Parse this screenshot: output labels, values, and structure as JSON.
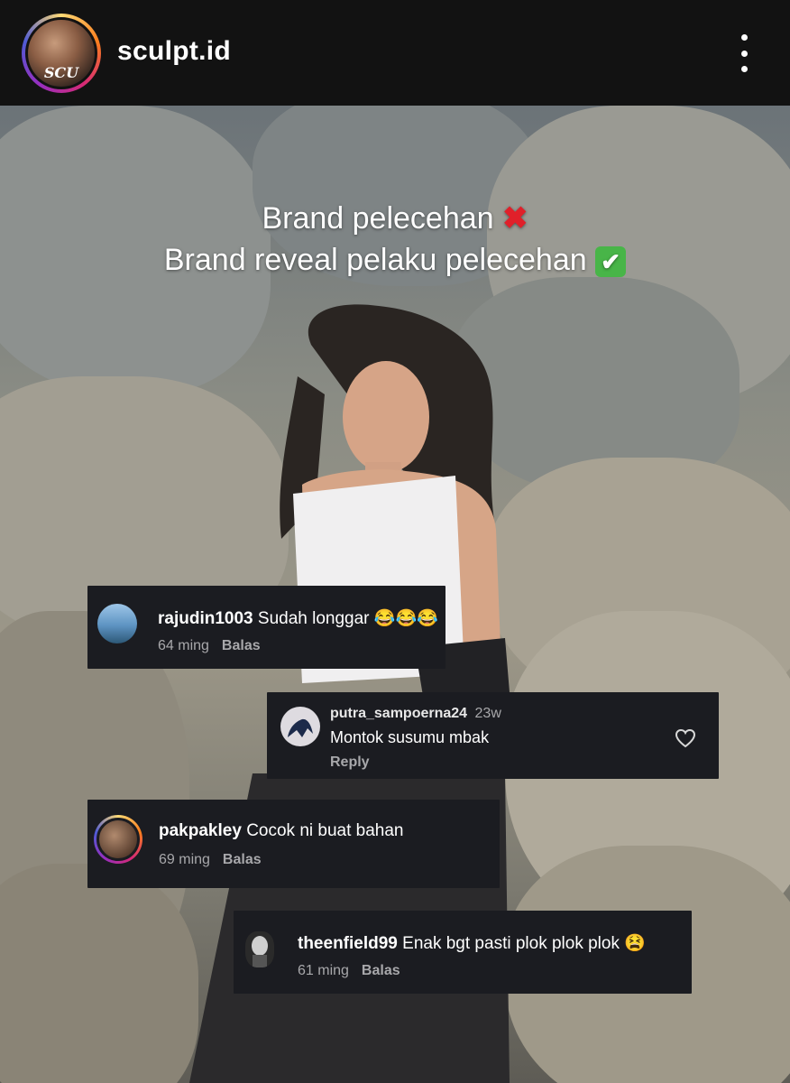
{
  "header": {
    "username": "sculpt.id",
    "avatar_text": "SCU"
  },
  "post": {
    "headline_line1": "Brand pelecehan",
    "headline_line1_emoji": "✖",
    "headline_line2": "Brand reveal pelaku pelecehan",
    "headline_line2_emoji": "✔"
  },
  "comments": [
    {
      "username": "rajudin1003",
      "text": "Sudah longgar",
      "emoji": "😂😂😂",
      "time": "64 ming",
      "reply_label": "Balas"
    },
    {
      "username": "putra_sampoerna24",
      "time": "23w",
      "text": "Montok susumu mbak",
      "reply_label": "Reply"
    },
    {
      "username": "pakpakley",
      "text": "Cocok ni buat bahan",
      "time": "69 ming",
      "reply_label": "Balas"
    },
    {
      "username": "theenfield99",
      "text": "Enak bgt pasti plok plok plok",
      "emoji": "😫",
      "time": "61 ming",
      "reply_label": "Balas"
    }
  ],
  "colors": {
    "topbar_bg": "#121212",
    "comment_bg": "#1b1c21",
    "meta_text": "#a8a8ab",
    "ring_gradient": [
      "#feda75",
      "#fa7e1e",
      "#d62976",
      "#962fbf",
      "#4f5bd5"
    ]
  }
}
